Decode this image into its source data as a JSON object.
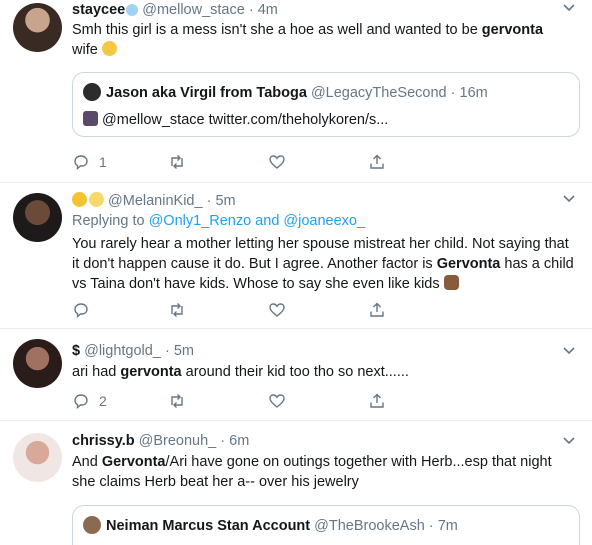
{
  "tweets": [
    {
      "name": "staycee",
      "handle": "@mellow_stace",
      "time": "4m",
      "text_before": "Smh this girl is a mess isn't she a hoe as well and wanted to be ",
      "text_bold": "gervonta",
      "text_after": " wife",
      "quote": {
        "name": "Jason aka Virgil from Taboga",
        "handle": "@LegacyTheSecond",
        "time": "16m",
        "text": "@mellow_stace twitter.com/theholykoren/s..."
      },
      "reply_count": "1"
    },
    {
      "name": "",
      "handle": "@MelaninKid_",
      "time": "5m",
      "replying_prefix": "Replying to ",
      "replying_user1": "@Only1_Renzo",
      "replying_and": " and ",
      "replying_user2": "@joaneexo_",
      "text_before": "You rarely hear a mother letting her spouse mistreat her child. Not saying that it don't happen cause it do. But I agree. Another factor is ",
      "text_bold": "Gervonta",
      "text_after": " has a child vs Taina don't have kids. Whose to say she even like kids",
      "reply_count": ""
    },
    {
      "name": "$",
      "handle": "@lightgold_",
      "time": "5m",
      "text_before": "ari had ",
      "text_bold": "gervonta",
      "text_after": " around their kid too tho so next......",
      "reply_count": "2"
    },
    {
      "name": "chrissy.b",
      "handle": "@Breonuh_",
      "time": "6m",
      "text_before": "And ",
      "text_bold": "Gervonta",
      "text_after": "/Ari have gone on outings together with Herb...esp that night she claims Herb beat her a-- over his jewelry",
      "quote": {
        "name": "Neiman Marcus Stan Account",
        "handle": "@TheBrookeAsh",
        "time": "7m",
        "text": ""
      },
      "reply_count": ""
    }
  ],
  "separator": "·",
  "icons": [
    "reply-icon",
    "retweet-icon",
    "like-icon",
    "share-icon",
    "chevron-down-icon"
  ],
  "colors": {
    "link": "#1da1f2",
    "muted": "#657786",
    "border": "#e6ecf0"
  }
}
